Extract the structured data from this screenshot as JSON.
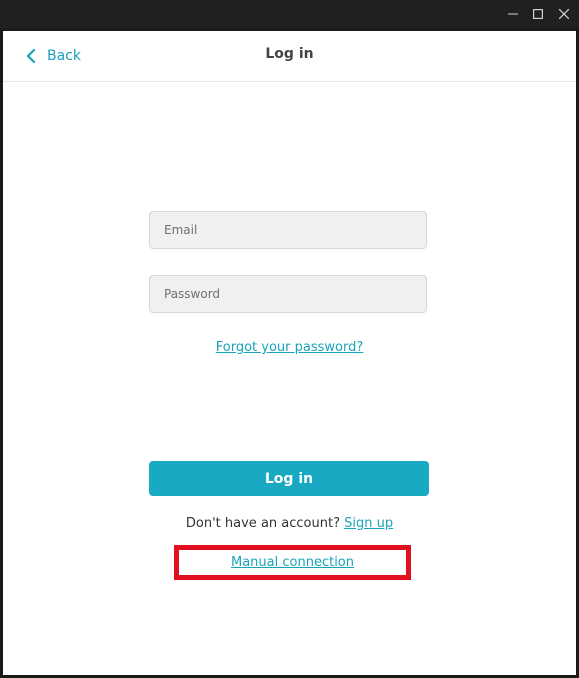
{
  "window_controls": {
    "minimize_icon": "minimize-icon",
    "maximize_icon": "maximize-icon",
    "close_icon": "close-icon"
  },
  "header": {
    "back_label": "Back",
    "back_icon": "chevron-left-icon",
    "title": "Log in"
  },
  "form": {
    "email": {
      "placeholder": "Email",
      "value": ""
    },
    "password": {
      "placeholder": "Password",
      "value": ""
    },
    "forgot_link": "Forgot your password?",
    "login_button": "Log in",
    "no_account_text": "Don't have an account?",
    "signup_link": "Sign up",
    "manual_connection_link": "Manual connection"
  },
  "colors": {
    "accent": "#1aa3b8",
    "button_bg": "#1aa9c3",
    "highlight_border": "#e01020"
  }
}
